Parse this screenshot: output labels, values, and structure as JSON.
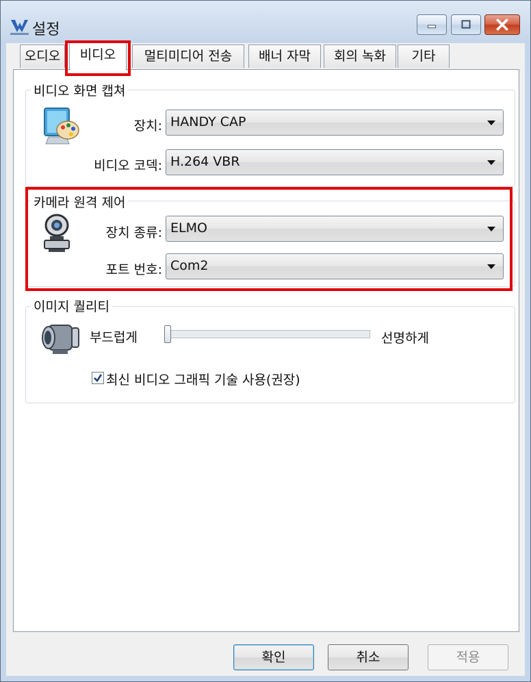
{
  "window": {
    "title": "설정"
  },
  "tabs": [
    {
      "label": "오디오"
    },
    {
      "label": "비디오"
    },
    {
      "label": "멀티미디어 전송"
    },
    {
      "label": "배너 자막"
    },
    {
      "label": "회의 녹화"
    },
    {
      "label": "기타"
    }
  ],
  "video_capture": {
    "group_label": "비디오 화면 캡쳐",
    "device_label": "장치:",
    "device_value": "HANDY CAP",
    "codec_label": "비디오 코덱:",
    "codec_value": "H.264 VBR"
  },
  "camera_control": {
    "group_label": "카메라 원격 제어",
    "type_label": "장치 종류:",
    "type_value": "ELMO",
    "port_label": "포트 번호:",
    "port_value": "Com2"
  },
  "image_quality": {
    "group_label": "이미지 퀄리티",
    "smooth_label": "부드럽게",
    "sharp_label": "선명하게",
    "slider_value": 0,
    "checkbox_label": "최신 비디오 그래픽 기술 사용(권장)",
    "checkbox_checked": true
  },
  "buttons": {
    "ok": "확인",
    "cancel": "취소",
    "apply": "적용"
  },
  "colors": {
    "highlight": "#e0060a"
  },
  "icons": {
    "app": "app-logo-icon",
    "capture": "monitor-palette-icon",
    "camera_control": "webcam-icon",
    "image_quality": "camcorder-icon"
  }
}
